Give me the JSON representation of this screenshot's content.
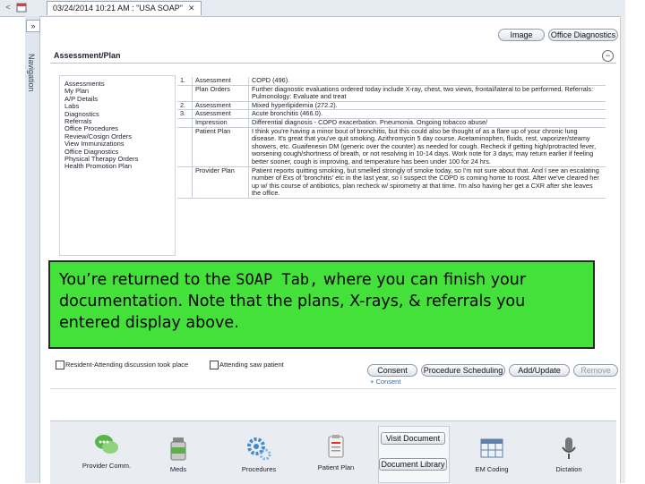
{
  "tab": {
    "back_glyph": "<",
    "title": "03/24/2014 10:21 AM : \"USA SOAP\"",
    "close": "✕"
  },
  "nav": {
    "toggle": "»",
    "label": "Navigation"
  },
  "toolbar": {
    "image_label": "Image",
    "office_diag_label": "Office Diagnostics"
  },
  "section": {
    "title": "Assessment/Plan",
    "collapse_glyph": "−"
  },
  "left_list": [
    "Assessments",
    "My Plan",
    "A/P Details",
    "Labs",
    "Diagnostics",
    "Referrals",
    "Office Procedures",
    "Review/Cosign Orders",
    "View Immunizations",
    "Office Diagnostics",
    "Physical Therapy Orders",
    "Health Promotion Plan"
  ],
  "rows": [
    {
      "num": "1.",
      "label": "Assessment",
      "text": "COPD (496)."
    },
    {
      "num": "",
      "label": "Plan Orders",
      "text": "Further diagnostic evaluations ordered today include X-ray, chest, two views, frontal/lateral to be performed. Referrals: Pulmonology: Evaluate and treat"
    },
    {
      "num": "2.",
      "label": "Assessment",
      "text": "Mixed hyperlipidemia (272.2)."
    },
    {
      "num": "3.",
      "label": "Assessment",
      "text": "Acute bronchitis (466.0)."
    },
    {
      "num": "",
      "label": "Impression",
      "text": "Differential diagnosis - COPD exacerbation. Pneumonia. Ongoing tobacco abuse/"
    },
    {
      "num": "",
      "label": "Patient Plan",
      "text": "I think you're having a minor bout of bronchitis, but this could also be thought of as a flare up of your chronic lung disease. It's great that you've quit smoking. Azithromycin 5 day course. Acetaminophen, fluids, rest, vaporizer/steamy showers, etc. Guaifenesin DM (generic over the counter) as needed for cough. Recheck if getting high/protracted fever, worsening cough/shortness of breath, or not resolving in 10-14 days. Work note for 3 days; may return earlier if feeling better sooner, cough is improving, and temperature has been under 100 for 24 hrs."
    },
    {
      "num": "",
      "label": "Provider Plan",
      "text": "Patient reports quitting smoking, but smelled strongly of smoke today, so I'm not sure about that. And I see an escalating number of Exs of 'bronchitis' etc in the last year, so I suspect the COPD is coming home to roost. After we've cleared her up w/ this course of antibiotics, plan recheck w/ spirometry at that time. I'm also having her get a CXR after she leaves the office."
    }
  ],
  "callout": {
    "before": "You’re returned to the ",
    "emphasis": "SOAP Tab,",
    "after": " where you can finish your documentation.  Note that the plans, X-rays, & referrals you entered display above."
  },
  "checkboxes": {
    "resident": "Resident-Attending discussion took place",
    "attending": "Attending saw patient"
  },
  "actions": {
    "consent": "Consent",
    "procedure_scheduling": "Procedure Scheduling",
    "add_update": "Add/Update",
    "remove": "Remove",
    "plus_consent": "+ Consent"
  },
  "dock": {
    "provider_comm": "Provider Comm.",
    "meds": "Meds",
    "procedures": "Procedures",
    "patient_plan": "Patient Plan",
    "visit_document": "Visit Document",
    "document_library": "Document Library",
    "em_coding": "EM Coding",
    "dictation": "Dictation"
  },
  "colors": {
    "callout_bg": "#44e13a",
    "link": "#3366aa"
  }
}
